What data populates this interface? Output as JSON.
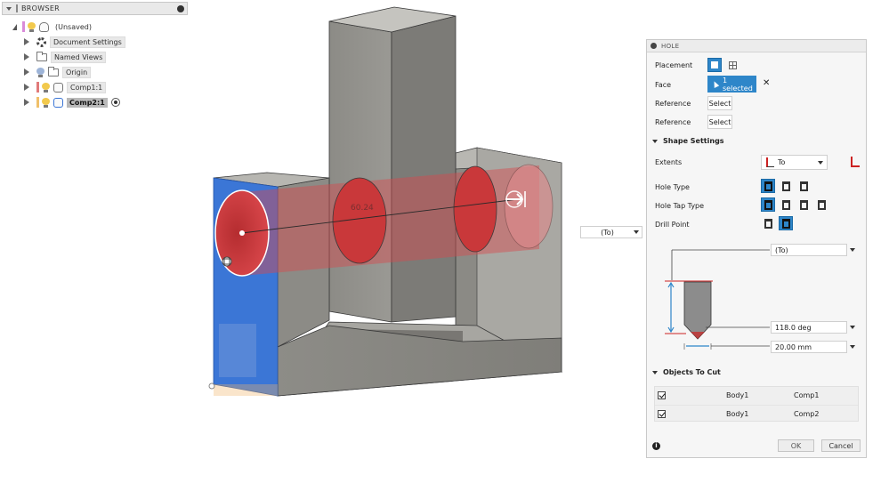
{
  "browser": {
    "title": "BROWSER",
    "items": [
      {
        "label": "(Unsaved)"
      },
      {
        "label": "Document Settings"
      },
      {
        "label": "Named Views"
      },
      {
        "label": "Origin"
      },
      {
        "label": "Comp1:1"
      },
      {
        "label": "Comp2:1"
      }
    ]
  },
  "viewport": {
    "dimension_label": "60.24",
    "float_dropdown_value": "(To)"
  },
  "hole_dialog": {
    "title": "HOLE",
    "placement_label": "Placement",
    "face_label": "Face",
    "face_value": "1 selected",
    "face_clear": "✕",
    "reference1_label": "Reference",
    "reference1_button": "Select",
    "reference2_label": "Reference",
    "reference2_button": "Select",
    "shape_settings_label": "Shape Settings",
    "extents_label": "Extents",
    "extents_value": "To",
    "hole_type_label": "Hole Type",
    "hole_tap_type_label": "Hole Tap Type",
    "drill_point_label": "Drill Point",
    "diagram_to_value": "(To)",
    "diagram_angle_value": "118.0 deg",
    "diagram_diameter_value": "20.00 mm",
    "objects_to_cut_label": "Objects To Cut",
    "cut_rows": [
      {
        "body": "Body1",
        "component": "Comp1"
      },
      {
        "body": "Body1",
        "component": "Comp2"
      }
    ],
    "info_icon": "i",
    "ok_label": "OK",
    "cancel_label": "Cancel"
  },
  "colors": {
    "accent": "#2e86c9",
    "hole_red": "#c9383a",
    "body_gray": "#8a8a86",
    "selected_face": "#3b76d6"
  }
}
